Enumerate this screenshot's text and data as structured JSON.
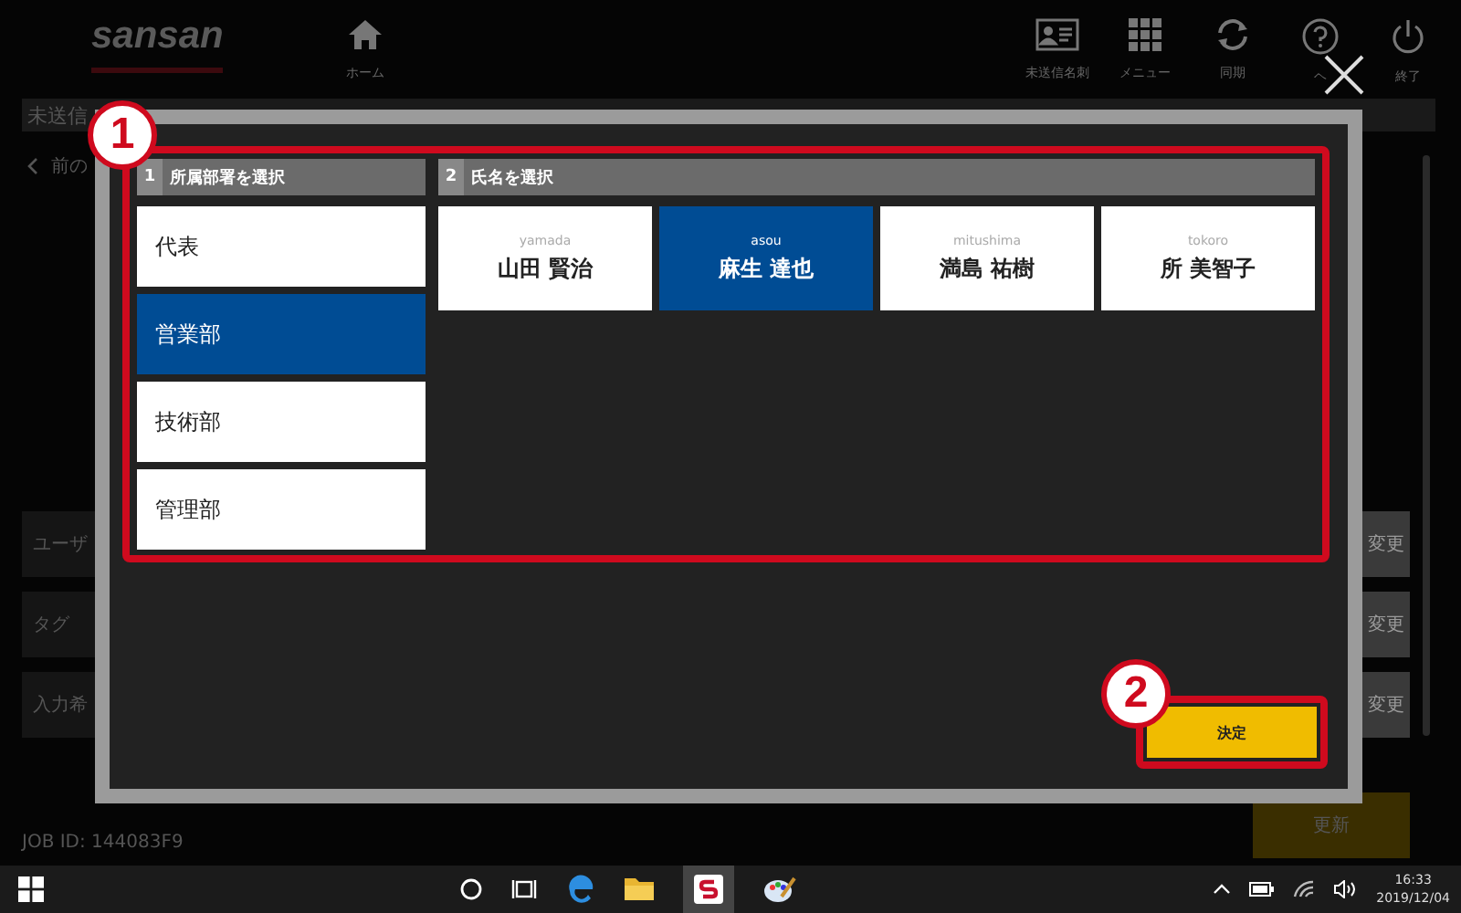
{
  "header": {
    "logo": "sansan",
    "nav": [
      {
        "label": "ホーム"
      }
    ],
    "tools": [
      {
        "label": "未送信名刺"
      },
      {
        "label": "メニュー"
      },
      {
        "label": "同期"
      },
      {
        "label": "ヘ"
      },
      {
        "label": "終了"
      }
    ]
  },
  "breadcrumb": "未送信",
  "back_link": "前の",
  "rows": [
    {
      "label": "ユーザ",
      "button": "変更"
    },
    {
      "label": "タグ",
      "button": "変更"
    },
    {
      "label": "入力希",
      "button": "変更"
    }
  ],
  "job_id": "JOB ID: 144083F9",
  "update_button": "更新",
  "dialog": {
    "callouts": [
      "1",
      "2"
    ],
    "departments": {
      "step": "1",
      "title": "所属部署を選択",
      "items": [
        {
          "label": "代表",
          "selected": false
        },
        {
          "label": "営業部",
          "selected": true
        },
        {
          "label": "技術部",
          "selected": false
        },
        {
          "label": "管理部",
          "selected": false
        }
      ]
    },
    "people": {
      "step": "2",
      "title": "氏名を選択",
      "items": [
        {
          "reading": "yamada",
          "name": "山田 賢治",
          "selected": false
        },
        {
          "reading": "asou",
          "name": "麻生 達也",
          "selected": true
        },
        {
          "reading": "mitushima",
          "name": "満島 祐樹",
          "selected": false
        },
        {
          "reading": "tokoro",
          "name": "所 美智子",
          "selected": false
        }
      ]
    },
    "confirm_button": "決定"
  },
  "taskbar": {
    "time": "16:33",
    "date": "2019/12/04"
  }
}
